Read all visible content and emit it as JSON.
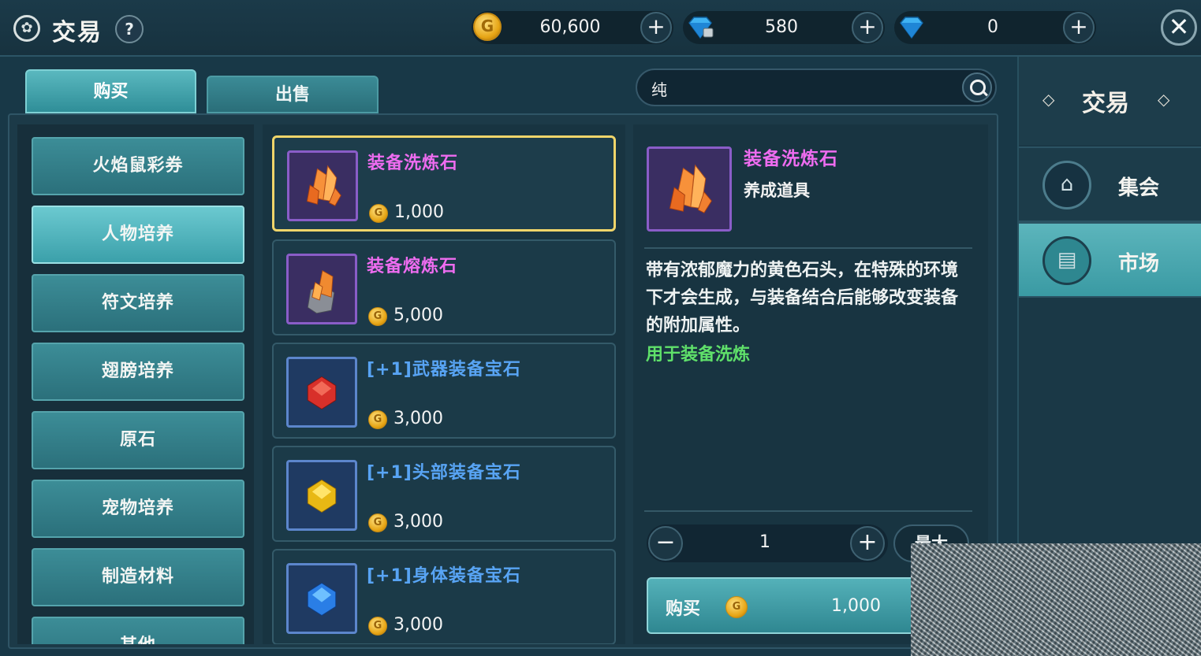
{
  "header": {
    "title": "交易",
    "help_label": "?",
    "gold_value": "60,600",
    "bound_diamond_value": "580",
    "diamond_value": "0",
    "plus_label": "+",
    "close_label": "✕"
  },
  "tabs": {
    "buy": "购买",
    "sell": "出售"
  },
  "search": {
    "value": "纯"
  },
  "categories": [
    {
      "label": "火焰鼠彩券"
    },
    {
      "label": "人物培养"
    },
    {
      "label": "符文培养"
    },
    {
      "label": "翅膀培养"
    },
    {
      "label": "原石"
    },
    {
      "label": "宠物培养"
    },
    {
      "label": "制造材料"
    },
    {
      "label": "其他"
    }
  ],
  "items": [
    {
      "name": "装备洗炼石",
      "price": "1,000",
      "icon": "orange-crystal-icon"
    },
    {
      "name": "装备熔炼石",
      "price": "5,000",
      "icon": "molten-stone-icon"
    },
    {
      "name": "[+1]武器装备宝石",
      "price": "3,000",
      "icon": "red-gem-icon"
    },
    {
      "name": "[+1]头部装备宝石",
      "price": "3,000",
      "icon": "yellow-gem-icon"
    },
    {
      "name": "[+1]身体装备宝石",
      "price": "3,000",
      "icon": "blue-gem-icon"
    }
  ],
  "detail": {
    "name": "装备洗炼石",
    "type": "养成道具",
    "description": "带有浓郁魔力的黄色石头，在特殊的环境下才会生成，与装备结合后能够改变装备的附加属性。",
    "usage": "用于装备洗炼",
    "quantity": "1",
    "minus_label": "−",
    "plus_label": "+",
    "max_label": "最大",
    "buy_label": "购买",
    "buy_price": "1,000"
  },
  "sidebar": {
    "title": "交易",
    "items": [
      {
        "label": "集会",
        "icon": "bag-icon"
      },
      {
        "label": "市场",
        "icon": "market-icon"
      }
    ]
  },
  "colors": {
    "accent": "#3ba0aa",
    "selected_border": "#f0d56a",
    "purple_name": "#ee6cf0",
    "blue_name": "#58a4f4",
    "usage_green": "#5fe06a"
  }
}
